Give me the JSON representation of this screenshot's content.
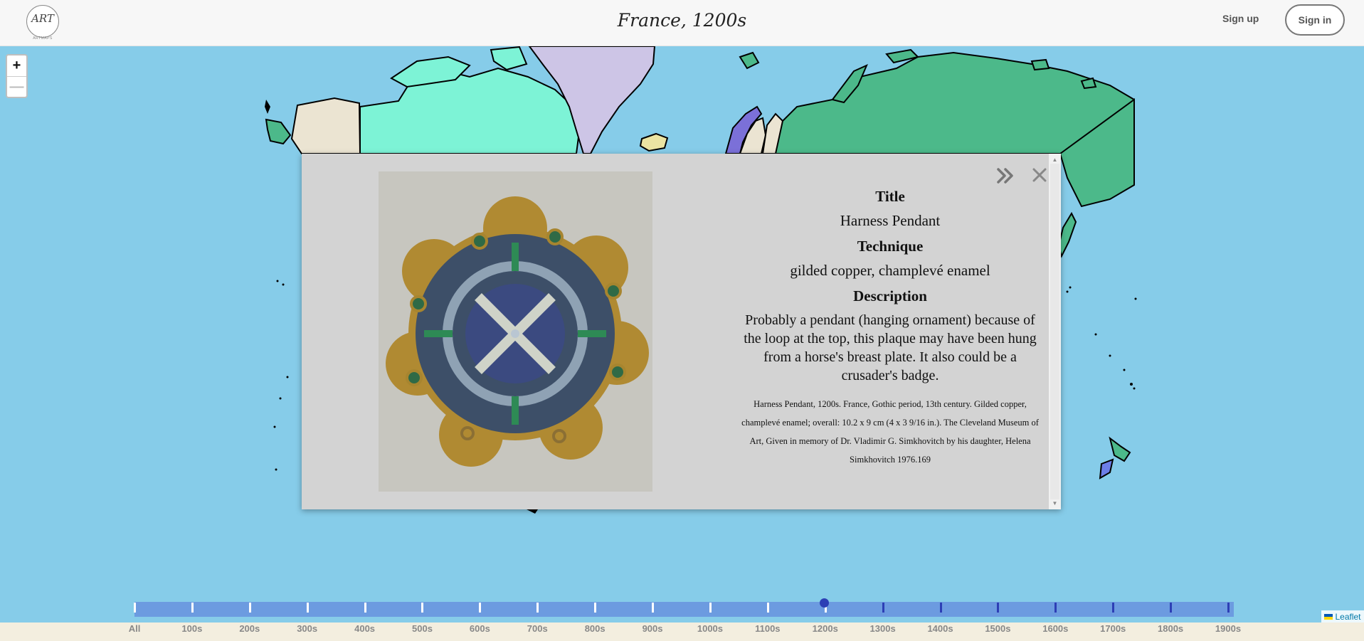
{
  "header": {
    "logo_text": "ART",
    "logo_subtext": "ARTMAPS",
    "title": "France, 1200s",
    "signup_label": "Sign up",
    "signin_label": "Sign in"
  },
  "map_controls": {
    "zoom_in": "+",
    "zoom_out": "—"
  },
  "popup": {
    "title_label": "Title",
    "title_value": "Harness Pendant",
    "technique_label": "Technique",
    "technique_value": "gilded copper, champlevé enamel",
    "description_label": "Description",
    "description_value": "Probably a pendant (hanging ornament) because of the loop at the top, this plaque may have been hung from a horse's breast plate. It also could be a crusader's badge.",
    "credit": "Harness Pendant, 1200s. France, Gothic period, 13th century. Gilded copper, champlevé enamel; overall: 10.2 x 9 cm (4 x 3 9/16 in.). The Cleveland Museum of Art, Given in memory of Dr. Vladimir G. Simkhovitch by his daughter, Helena Simkhovitch 1976.169",
    "next_icon": "double-chevron-right-icon",
    "close_icon": "close-icon"
  },
  "timeline": {
    "labels": [
      "All",
      "100s",
      "200s",
      "300s",
      "400s",
      "500s",
      "600s",
      "700s",
      "800s",
      "900s",
      "1000s",
      "1100s",
      "1200s",
      "1300s",
      "1400s",
      "1500s",
      "1600s",
      "1700s",
      "1800s",
      "1900s"
    ],
    "selected": "1200s",
    "colors": {
      "track": "#6c9be0",
      "handle": "#2d3fb5",
      "tick_before": "#ffffff",
      "tick_after": "#2d3fb5"
    }
  },
  "attribution": "Leaflet",
  "colors": {
    "ocean": "#86cce9",
    "greenland": "#cdc5e6",
    "canada": "#7df3d6",
    "alaska": "#ebe4d2",
    "russia": "#4cb98a"
  }
}
